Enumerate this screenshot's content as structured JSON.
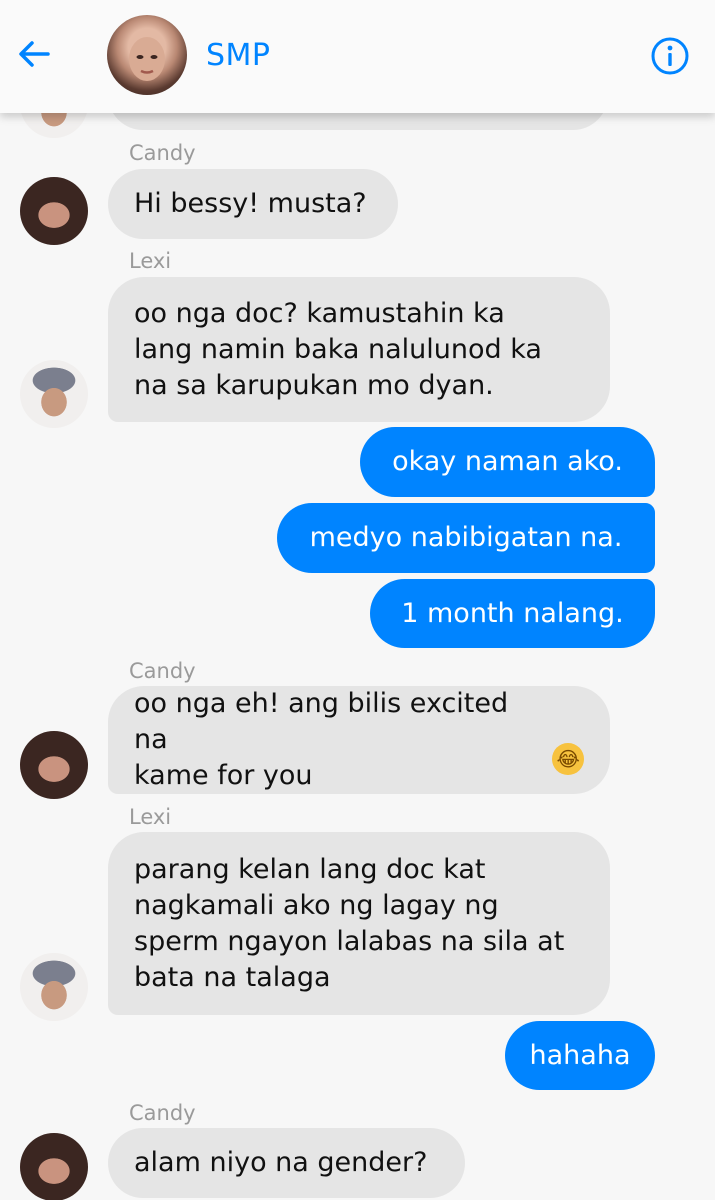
{
  "header": {
    "title": "SMP",
    "back_icon": "back-arrow-icon",
    "info_icon": "info-icon",
    "accent_color": "#0084ff"
  },
  "messages": [
    {
      "sender": "Candy",
      "text": "Hi bessy! musta?",
      "direction": "in"
    },
    {
      "sender": "Lexi",
      "text": "oo nga doc? kamustahin ka\nlang namin baka nalulunod ka\nna sa karupukan mo dyan.",
      "direction": "in"
    },
    {
      "text": "okay naman ako.",
      "direction": "out"
    },
    {
      "text": "medyo nabibigatan na.",
      "direction": "out"
    },
    {
      "text": "1 month nalang.",
      "direction": "out"
    },
    {
      "sender": "Candy",
      "text": "oo nga eh! ang bilis excited na\nkame for you",
      "emoji": "tears-of-joy-face",
      "direction": "in"
    },
    {
      "sender": "Lexi",
      "text": "parang kelan lang doc kat\nnagkamali ako ng lagay ng\nsperm ngayon lalabas na sila at\nbata na talaga",
      "direction": "in"
    },
    {
      "text": "hahaha",
      "direction": "out"
    },
    {
      "sender": "Candy",
      "text": "alam niyo na gender?",
      "direction": "in"
    }
  ],
  "colors": {
    "outgoing_bubble": "#0084ff",
    "incoming_bubble": "#e5e5e5",
    "sender_label": "#9a9a9a"
  }
}
